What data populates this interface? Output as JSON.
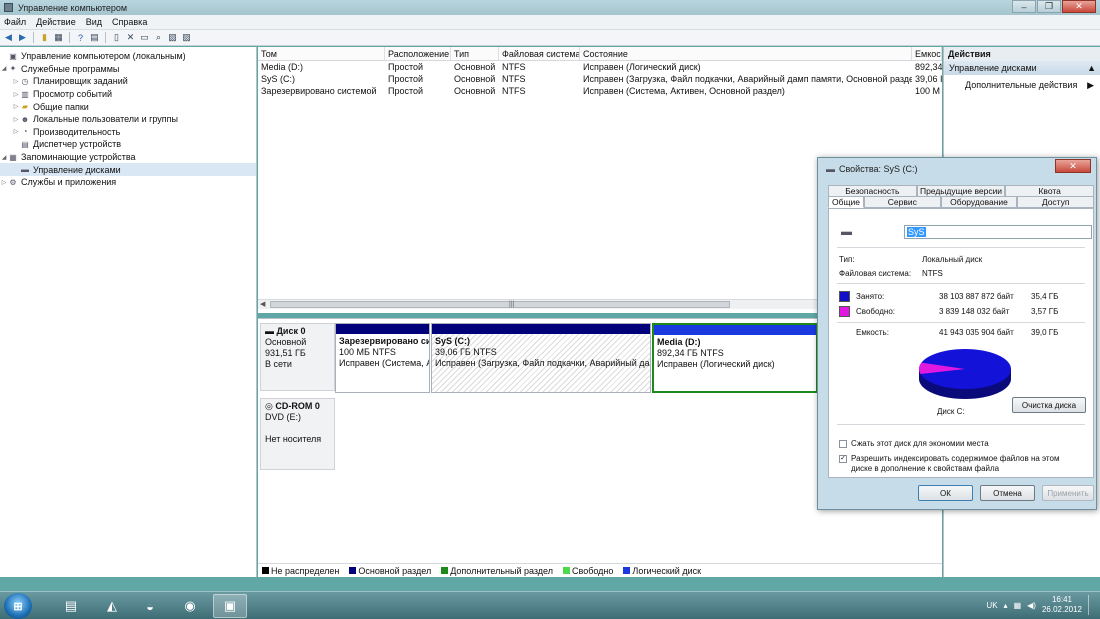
{
  "window": {
    "title": "Управление компьютером",
    "buttons": [
      "–",
      "❐",
      "✕"
    ]
  },
  "menu": [
    "Файл",
    "Действие",
    "Вид",
    "Справка"
  ],
  "tree": [
    {
      "label": "Управление компьютером (локальным)",
      "icon": "computer-icon"
    },
    {
      "label": "Служебные программы",
      "icon": "tools-icon"
    },
    {
      "label": "Планировщик заданий",
      "icon": "clock-icon"
    },
    {
      "label": "Просмотр событий",
      "icon": "event-icon"
    },
    {
      "label": "Общие папки",
      "icon": "folder-icon"
    },
    {
      "label": "Локальные пользователи и группы",
      "icon": "users-icon"
    },
    {
      "label": "Производительность",
      "icon": "performance-icon"
    },
    {
      "label": "Диспетчер устройств",
      "icon": "device-icon"
    },
    {
      "label": "Запоминающие устройства",
      "icon": "storage-icon"
    },
    {
      "label": "Управление дисками",
      "icon": "disk-icon"
    },
    {
      "label": "Службы и приложения",
      "icon": "services-icon"
    }
  ],
  "volumes": {
    "headers": [
      "Том",
      "Расположение",
      "Тип",
      "Файловая система",
      "Состояние",
      "Емкос"
    ],
    "rows": [
      [
        "Media (D:)",
        "Простой",
        "Основной",
        "NTFS",
        "Исправен (Логический диск)",
        "892,34"
      ],
      [
        "SyS (C:)",
        "Простой",
        "Основной",
        "NTFS",
        "Исправен (Загрузка, Файл подкачки, Аварийный дамп памяти, Основной раздел)",
        "39,06 I"
      ],
      [
        "Зарезервировано системой",
        "Простой",
        "Основной",
        "NTFS",
        "Исправен (Система, Активен, Основной раздел)",
        "100 М"
      ]
    ]
  },
  "disks": {
    "disk0": {
      "name": "Диск 0",
      "type": "Основной",
      "size": "931,51 ГБ",
      "status": "В сети"
    },
    "cdrom": {
      "name": "CD-ROM 0",
      "type": "DVD (E:)",
      "status": "Нет носителя"
    },
    "partitions": [
      {
        "name": "Зарезервировано си",
        "size": "100 МБ NTFS",
        "status": "Исправен (Система, А"
      },
      {
        "name": "SyS  (C:)",
        "size": "39,06 ГБ NTFS",
        "status": "Исправен (Загрузка, Файл подкачки, Аварийный дам"
      },
      {
        "name": "Media  (D:)",
        "size": "892,34 ГБ NTFS",
        "status": "Исправен (Логический диск)"
      }
    ]
  },
  "legend": [
    {
      "label": "Не распределен",
      "color": "#000000"
    },
    {
      "label": "Основной раздел",
      "color": "#00007a"
    },
    {
      "label": "Дополнительный раздел",
      "color": "#1b8a1b"
    },
    {
      "label": "Свободно",
      "color": "#4cd94c"
    },
    {
      "label": "Логический диск",
      "color": "#1a3ae0"
    }
  ],
  "actions": {
    "header": "Действия",
    "section": "Управление дисками",
    "more": "Дополнительные действия"
  },
  "dialog": {
    "title": "Свойства: SyS (C:)",
    "tabs_top": [
      "Безопасность",
      "Предыдущие версии",
      "Квота"
    ],
    "tabs_bottom": [
      "Общие",
      "Сервис",
      "Оборудование",
      "Доступ"
    ],
    "name_value": "SyS",
    "type_label": "Тип:",
    "type_value": "Локальный диск",
    "fs_label": "Файловая система:",
    "fs_value": "NTFS",
    "used_label": "Занято:",
    "used_bytes": "38 103 887 872 байт",
    "used_gb": "35,4 ГБ",
    "free_label": "Свободно:",
    "free_bytes": "3 839 148 032 байт",
    "free_gb": "3,57 ГБ",
    "cap_label": "Емкость:",
    "cap_bytes": "41 943 035 904 байт",
    "cap_gb": "39,0 ГБ",
    "disk_label": "Диск C:",
    "cleanup": "Очистка диска",
    "compress": "Сжать этот диск для экономии места",
    "index": "Разрешить индексировать содержимое файлов на этом диске в дополнение к свойствам файла",
    "ok": "ОК",
    "cancel": "Отмена",
    "apply": "Применить",
    "used_color": "#1010c8",
    "free_color": "#e018e0",
    "used_fraction": 0.908
  },
  "taskbar": {
    "lang": "UK",
    "time": "16:41",
    "date": "26.02.2012"
  }
}
